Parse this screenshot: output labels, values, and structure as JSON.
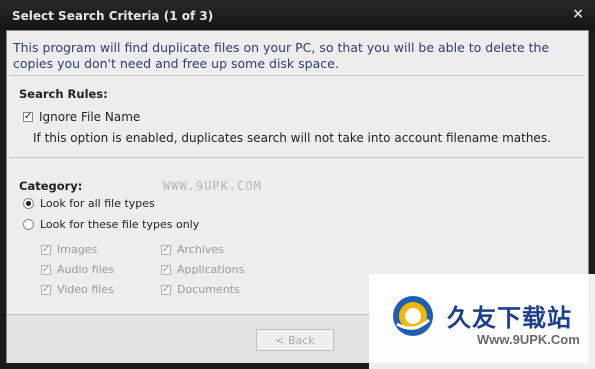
{
  "window": {
    "title": "Select Search Criteria (1 of 3)",
    "close_glyph": "×"
  },
  "intro_text": "This program will find duplicate files on your PC, so that you will be able to delete the copies you don't need and free up some disk space.",
  "search_rules": {
    "label": "Search Rules:",
    "ignore_file_name": {
      "label": "Ignore File Name",
      "checked": true
    },
    "description": "If this option is enabled, duplicates search will not take into account filename mathes."
  },
  "category": {
    "label": "Category:",
    "options": [
      {
        "label": "Look for all file types",
        "selected": true
      },
      {
        "label": "Look for these file types only",
        "selected": false
      }
    ],
    "file_types": [
      {
        "label": "Images",
        "checked": true,
        "enabled": false
      },
      {
        "label": "Archives",
        "checked": true,
        "enabled": false
      },
      {
        "label": "Audio files",
        "checked": true,
        "enabled": false
      },
      {
        "label": "Applications",
        "checked": true,
        "enabled": false
      },
      {
        "label": "Video files",
        "checked": true,
        "enabled": false
      },
      {
        "label": "Documents",
        "checked": true,
        "enabled": false
      }
    ]
  },
  "watermark_text": "WWW.9UPK.COM",
  "footer": {
    "back_label": "< Back"
  },
  "overlay_watermark": {
    "brand": "久友下载站",
    "url": "Www.9UPK.Com"
  },
  "icons": {
    "close": "close-icon",
    "checkmark": "checkmark-icon",
    "logo": "9upk-logo-icon"
  },
  "colors": {
    "title_bar": "#141414",
    "client_bg": "#ededed",
    "intro_text": "#2b3f73",
    "disabled_text": "#9a9a9a",
    "brand_blue": "#1c3f8c"
  }
}
